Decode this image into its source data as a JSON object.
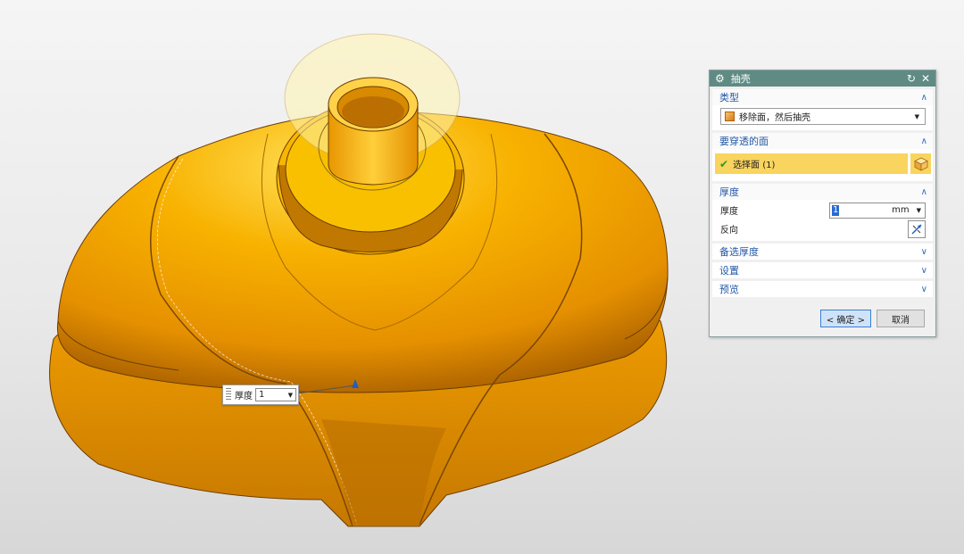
{
  "dialog": {
    "title": "抽壳",
    "icons": {
      "gear": "gear-icon",
      "reset": "reset-icon",
      "close": "close-icon"
    },
    "type_section": {
      "header": "类型",
      "selected": "移除面，然后抽壳"
    },
    "pierce_section": {
      "header": "要穿透的面",
      "select_label": "选择面 (1)"
    },
    "thickness_section": {
      "header": "厚度",
      "thickness_label": "厚度",
      "thickness_value": "1",
      "unit": "mm",
      "reverse_label": "反向"
    },
    "collapsed_sections": [
      "备选厚度",
      "设置",
      "预览"
    ],
    "buttons": {
      "ok": "< 确定 >",
      "cancel": "取消"
    }
  },
  "floating_input": {
    "label": "厚度",
    "value": "1"
  },
  "colors": {
    "title_bar": "#5f8b84",
    "section_header_text": "#2358a6",
    "highlight": "#f9d45e",
    "part_body": "#f6a800",
    "part_shadow": "#7a4600"
  }
}
